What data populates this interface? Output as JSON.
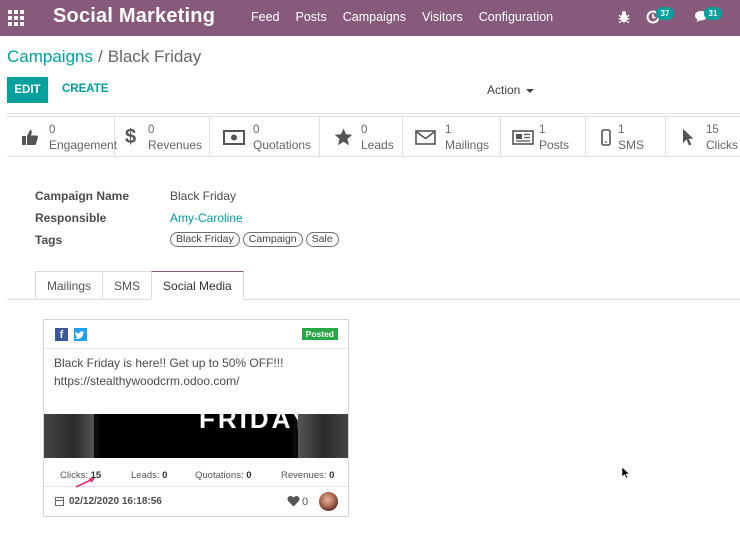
{
  "navbar": {
    "app_name": "Social Marketing",
    "menu": [
      "Feed",
      "Posts",
      "Campaigns",
      "Visitors",
      "Configuration"
    ],
    "activity_count": "37",
    "messages_count": "31"
  },
  "breadcrumb": {
    "parent": "Campaigns",
    "separator": "/",
    "current": "Black Friday"
  },
  "controls": {
    "edit": "EDIT",
    "create": "CREATE",
    "action": "Action"
  },
  "stats": [
    {
      "icon": "thumbs-up-icon",
      "value": "0",
      "label": "Engagement"
    },
    {
      "icon": "dollar-icon",
      "value": "0",
      "label": "Revenues"
    },
    {
      "icon": "money-icon",
      "value": "0",
      "label": "Quotations"
    },
    {
      "icon": "star-icon",
      "value": "0",
      "label": "Leads"
    },
    {
      "icon": "envelope-icon",
      "value": "1",
      "label": "Mailings"
    },
    {
      "icon": "newspaper-icon",
      "value": "1",
      "label": "Posts"
    },
    {
      "icon": "mobile-icon",
      "value": "1",
      "label": "SMS"
    },
    {
      "icon": "pointer-icon",
      "value": "15",
      "label": "Clicks"
    }
  ],
  "fields": {
    "campaign_name_label": "Campaign Name",
    "campaign_name": "Black Friday",
    "responsible_label": "Responsible",
    "responsible": "Amy-Caroline",
    "tags_label": "Tags",
    "tags": [
      "Black Friday",
      "Campaign",
      "Sale"
    ]
  },
  "tabs": [
    "Mailings",
    "SMS",
    "Social Media"
  ],
  "active_tab": "Social Media",
  "post": {
    "status": "Posted",
    "text_line1": "Black Friday is here!! Get up to 50% OFF!!!",
    "text_line2": "https://stealthywoodcrm.odoo.com/",
    "image_text": "FRIDAY",
    "metrics": {
      "clicks_label": "Clicks:",
      "clicks": "15",
      "leads_label": "Leads:",
      "leads": "0",
      "quotations_label": "Quotations:",
      "quotations": "0",
      "revenues_label": "Revenues:",
      "revenues": "0"
    },
    "date": "02/12/2020 16:18:56",
    "likes": "0"
  },
  "colors": {
    "brand": "#875a7b",
    "accent": "#00a09d",
    "posted": "#28a745",
    "arrow": "#e0306a"
  }
}
